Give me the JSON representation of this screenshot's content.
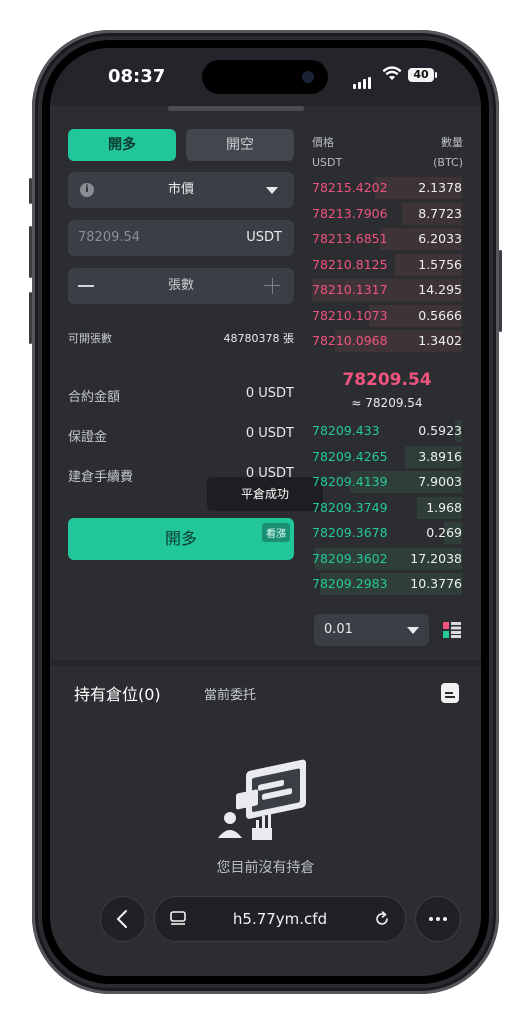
{
  "status": {
    "time": "08:37",
    "battery": "40"
  },
  "order": {
    "tab_long": "開多",
    "tab_short": "開空",
    "order_type": "市價",
    "price_placeholder": "78209.54",
    "price_unit": "USDT",
    "qty_label": "張數",
    "available_label": "可開張數",
    "available_value": "48780378 張",
    "contract_amount_label": "合約金額",
    "contract_amount_value": "0 USDT",
    "margin_label": "保證金",
    "margin_value": "0 USDT",
    "fee_label": "建倉手續費",
    "fee_value": "0 USDT",
    "submit_label": "開多",
    "submit_tag": "看漲"
  },
  "toast": "平倉成功",
  "orderbook": {
    "price_header": "價格",
    "qty_header": "數量",
    "price_unit": "USDT",
    "qty_unit": "(BTC)",
    "asks": [
      {
        "price": "78215.4202",
        "qty": "2.1378",
        "depth": 0.58
      },
      {
        "price": "78213.7906",
        "qty": "8.7723",
        "depth": 0.4
      },
      {
        "price": "78213.6851",
        "qty": "6.2033",
        "depth": 0.55
      },
      {
        "price": "78210.8125",
        "qty": "1.5756",
        "depth": 0.45
      },
      {
        "price": "78210.1317",
        "qty": "14.295",
        "depth": 1.0
      },
      {
        "price": "78210.1073",
        "qty": "0.5666",
        "depth": 0.62
      },
      {
        "price": "78210.0968",
        "qty": "1.3402",
        "depth": 0.85
      }
    ],
    "last_price": "78209.54",
    "last_approx": "≈ 78209.54",
    "bids": [
      {
        "price": "78209.433",
        "qty": "0.5923",
        "depth": 0.05
      },
      {
        "price": "78209.4265",
        "qty": "3.8916",
        "depth": 0.38
      },
      {
        "price": "78209.4139",
        "qty": "7.9003",
        "depth": 0.75
      },
      {
        "price": "78209.3749",
        "qty": "1.968",
        "depth": 0.3
      },
      {
        "price": "78209.3678",
        "qty": "0.269",
        "depth": 0.12
      },
      {
        "price": "78209.3602",
        "qty": "17.2038",
        "depth": 0.98
      },
      {
        "price": "78209.2983",
        "qty": "10.3776",
        "depth": 0.95
      }
    ],
    "precision": "0.01"
  },
  "positions": {
    "tab_holdings": "持有倉位(0)",
    "tab_orders": "當前委托",
    "empty_text": "您目前沒有持倉"
  },
  "browser": {
    "url": "h5.77ym.cfd"
  },
  "colors": {
    "accent_green": "#21c69b",
    "ask_red": "#f0537e",
    "bg": "#2b2d31"
  },
  "icons": [
    "info-icon",
    "caret-down-icon",
    "minus-icon",
    "plus-icon",
    "layout-icon",
    "document-icon",
    "back-icon",
    "tabs-icon",
    "reload-icon",
    "more-icon"
  ]
}
